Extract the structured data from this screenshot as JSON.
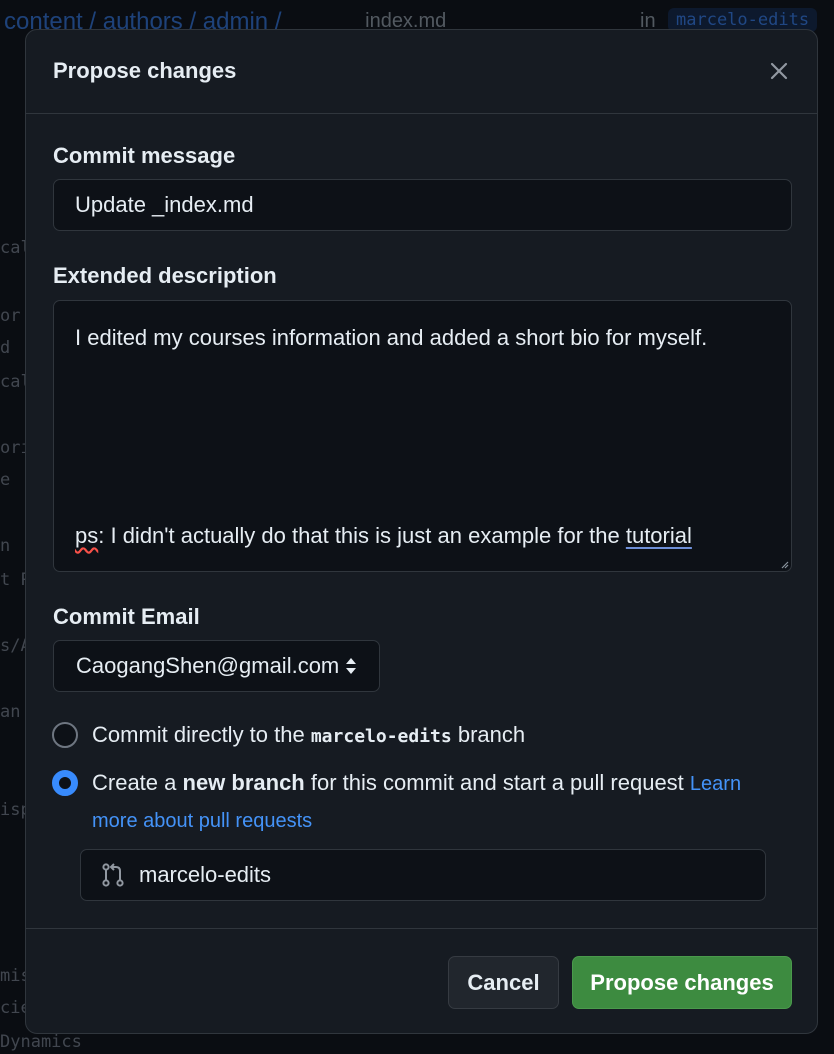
{
  "background": {
    "breadcrumb": "content / authors / admin /",
    "file": "_index.md",
    "in_label": "in",
    "branch_badge": "marcelo-edits",
    "code_fragments": [
      "cal",
      "or",
      "d",
      "cal",
      "ori",
      "e",
      "n",
      "t P",
      "s/A",
      "an",
      "isp",
      "mis",
      "cie",
      "Dynamics"
    ]
  },
  "modal": {
    "title": "Propose changes",
    "close_icon": "close-icon"
  },
  "commit_message": {
    "label": "Commit message",
    "value": "Update _index.md"
  },
  "extended_description": {
    "label": "Extended description",
    "line1": "I edited my courses information and added a short bio for myself.",
    "line2_misspelled": "ps",
    "line2_middle": ": I didn't actually do that this is just an example for the ",
    "line2_underlined": "tutorial"
  },
  "commit_email": {
    "label": "Commit Email",
    "selected": "CaogangShen@gmail.com"
  },
  "options": {
    "direct": {
      "prefix": "Commit directly to the ",
      "branch": "marcelo-edits",
      "suffix": " branch",
      "checked": false
    },
    "new_branch": {
      "prefix": "Create a ",
      "bold": "new branch",
      "suffix": " for this commit and start a pull request ",
      "link": "Learn more about pull requests",
      "checked": true
    }
  },
  "branch_name": {
    "value": "marcelo-edits",
    "icon": "git-pull-request-icon"
  },
  "footer": {
    "cancel_label": "Cancel",
    "submit_label": "Propose changes"
  },
  "colors": {
    "primary_button": "#3d8b40",
    "link": "#4493f8",
    "radio_selected": "#388bfd"
  }
}
